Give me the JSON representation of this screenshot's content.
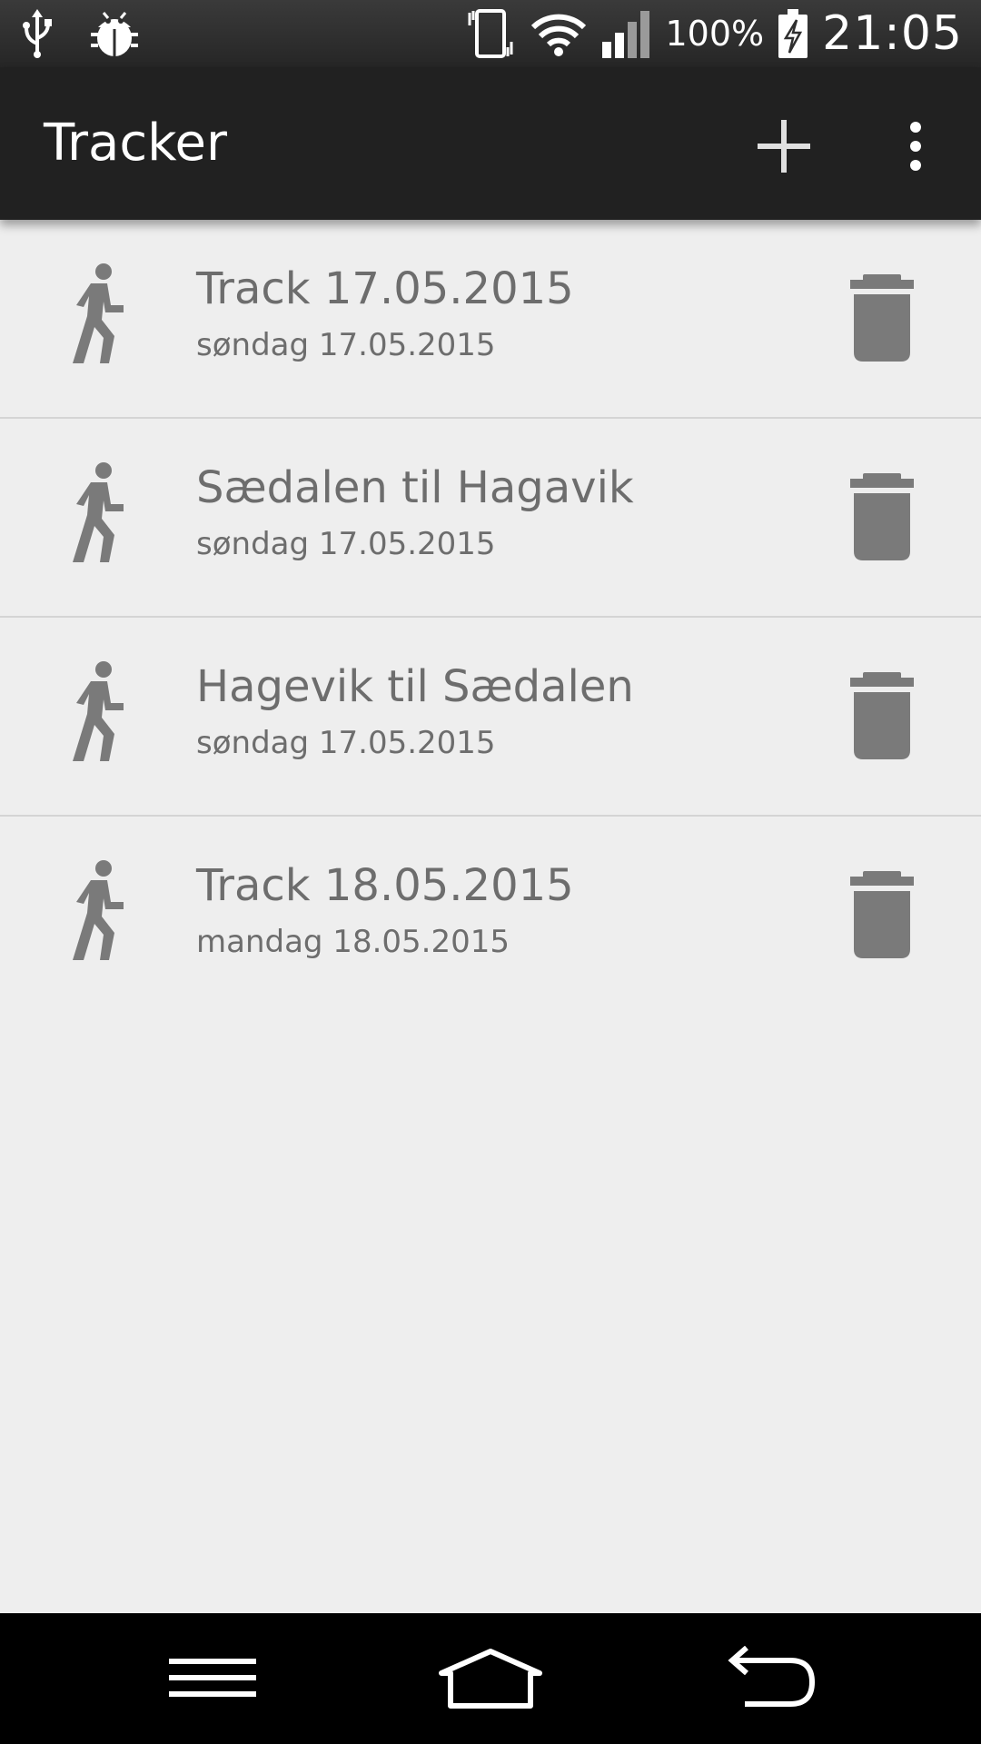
{
  "status_bar": {
    "battery_percent": "100%",
    "time": "21:05",
    "icons": [
      "usb-icon",
      "debug-bug-icon",
      "vibrate-icon",
      "wifi-icon",
      "signal-icon",
      "battery-charging-icon"
    ]
  },
  "action_bar": {
    "title": "Tracker",
    "actions": [
      "add-icon",
      "overflow-menu-icon"
    ]
  },
  "tracks": [
    {
      "title": "Track 17.05.2015",
      "date": "søndag 17.05.2015",
      "icon": "walking-person-icon"
    },
    {
      "title": "Sædalen til Hagavik",
      "date": "søndag 17.05.2015",
      "icon": "walking-person-icon"
    },
    {
      "title": "Hagevik til Sædalen",
      "date": "søndag 17.05.2015",
      "icon": "walking-person-icon"
    },
    {
      "title": "Track 18.05.2015",
      "date": "mandag 18.05.2015",
      "icon": "walking-person-icon"
    }
  ],
  "nav_bar": {
    "buttons": [
      "menu-icon",
      "home-icon",
      "back-icon"
    ]
  },
  "colors": {
    "status_bar": "#2e2e2e",
    "action_bar": "#212121",
    "background": "#eeeeee",
    "list_text": "#6d6d6d",
    "icon_gray": "#7a7a7a",
    "nav_bar": "#000000"
  }
}
